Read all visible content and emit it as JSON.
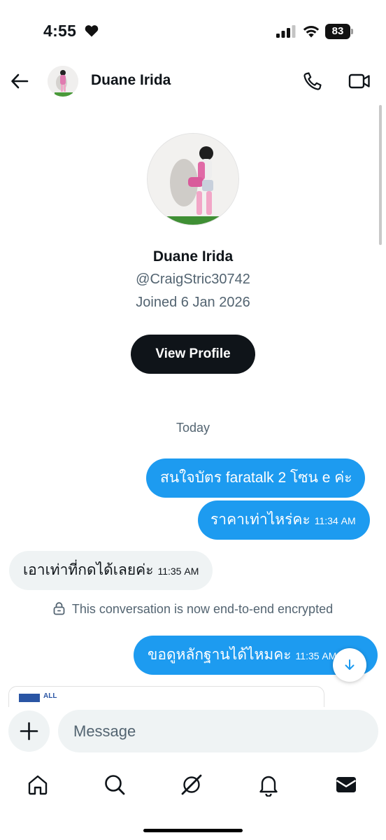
{
  "status_bar": {
    "time": "4:55",
    "battery": "83",
    "icons": [
      "heart-icon",
      "signal-icon",
      "wifi-icon",
      "battery-icon"
    ]
  },
  "header": {
    "name": "Duane Irida",
    "icons": [
      "back-arrow-icon",
      "phone-icon",
      "video-camera-icon"
    ]
  },
  "profile": {
    "name": "Duane Irida",
    "handle": "@CraigStric30742",
    "joined": "Joined 6 Jan 2026",
    "view_profile_label": "View Profile"
  },
  "conversation": {
    "day_separator": "Today",
    "messages": [
      {
        "direction": "outgoing",
        "text": "สนใจบัตร faratalk 2 โซน e ค่ะ",
        "time": ""
      },
      {
        "direction": "outgoing",
        "text": "ราคาเท่าไหร่คะ",
        "time": "11:34 AM"
      },
      {
        "direction": "incoming",
        "text": "เอาเท่าที่กดได้เลยค่ะ",
        "time": "11:35 AM"
      },
      {
        "direction": "outgoing",
        "text": "ขอดูหลักฐานได้ไหมคะ",
        "time": "11:35 AM"
      }
    ],
    "encryption_notice": "This conversation is now end-to-end encrypted",
    "image_preview_text": "ALL"
  },
  "composer": {
    "placeholder": "Message"
  },
  "bottom_nav": {
    "items": [
      "home-icon",
      "search-icon",
      "grok-icon",
      "notifications-bell-icon",
      "messages-envelope-icon"
    ]
  },
  "colors": {
    "accent": "#1d9bf0",
    "text_primary": "#0f1419",
    "text_secondary": "#536471",
    "bubble_incoming": "#eff3f4",
    "button_dark": "#0f1419"
  }
}
